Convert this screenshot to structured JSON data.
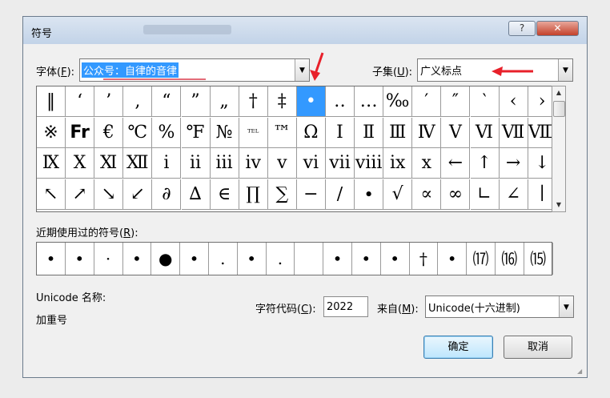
{
  "window": {
    "title": "符号",
    "help_label": "?",
    "close_label": "✕"
  },
  "font": {
    "label": "字体(",
    "key": "F",
    "label_end": "):",
    "value": "公众号：自律的音律"
  },
  "subset": {
    "label": "子集(",
    "key": "U",
    "label_end": "):",
    "value": "广义标点"
  },
  "symbol_grid": [
    [
      "‖",
      "‘",
      "’",
      "‚",
      "“",
      "”",
      "„",
      "†",
      "‡",
      "•",
      "‥",
      "…",
      "‰",
      "′",
      "″",
      "‵",
      "‹",
      "›"
    ],
    [
      "※",
      "Fr",
      "€",
      "℃",
      "%",
      "℉",
      "№",
      "ᵀᴱᴸ",
      "™",
      "Ω",
      "Ⅰ",
      "Ⅱ",
      "Ⅲ",
      "Ⅳ",
      "Ⅴ",
      "Ⅵ",
      "Ⅶ",
      "Ⅷ"
    ],
    [
      "Ⅸ",
      "Ⅹ",
      "Ⅺ",
      "Ⅻ",
      "ⅰ",
      "ⅱ",
      "ⅲ",
      "ⅳ",
      "ⅴ",
      "ⅵ",
      "ⅶ",
      "ⅷ",
      "ⅸ",
      "ⅹ",
      "←",
      "↑",
      "→",
      "↓"
    ],
    [
      "↖",
      "↗",
      "↘",
      "↙",
      "∂",
      "∆",
      "∈",
      "∏",
      "∑",
      "−",
      "∕",
      "∙",
      "√",
      "∝",
      "∞",
      "∟",
      "∠",
      "∣"
    ]
  ],
  "selected_symbol": "•",
  "recent": {
    "label": "近期使用过的符号(",
    "key": "R",
    "label_end": "):",
    "items": [
      "•",
      "•",
      "·",
      "•",
      "●",
      "•",
      ".",
      "•",
      ".",
      "",
      "•",
      "•",
      "•",
      "†",
      "•",
      "⒄",
      "⒃",
      "⒂"
    ]
  },
  "unicode_name": {
    "label": "Unicode 名称:",
    "value": "加重号"
  },
  "char_code": {
    "label": "字符代码(",
    "key": "C",
    "label_end": "):",
    "value": "2022"
  },
  "from": {
    "label": "来自(",
    "key": "M",
    "label_end": "):",
    "value": "Unicode(十六进制)"
  },
  "buttons": {
    "ok": "确定",
    "cancel": "取消"
  },
  "colors": {
    "selection": "#3399ff",
    "annotation": "#e8202a"
  }
}
